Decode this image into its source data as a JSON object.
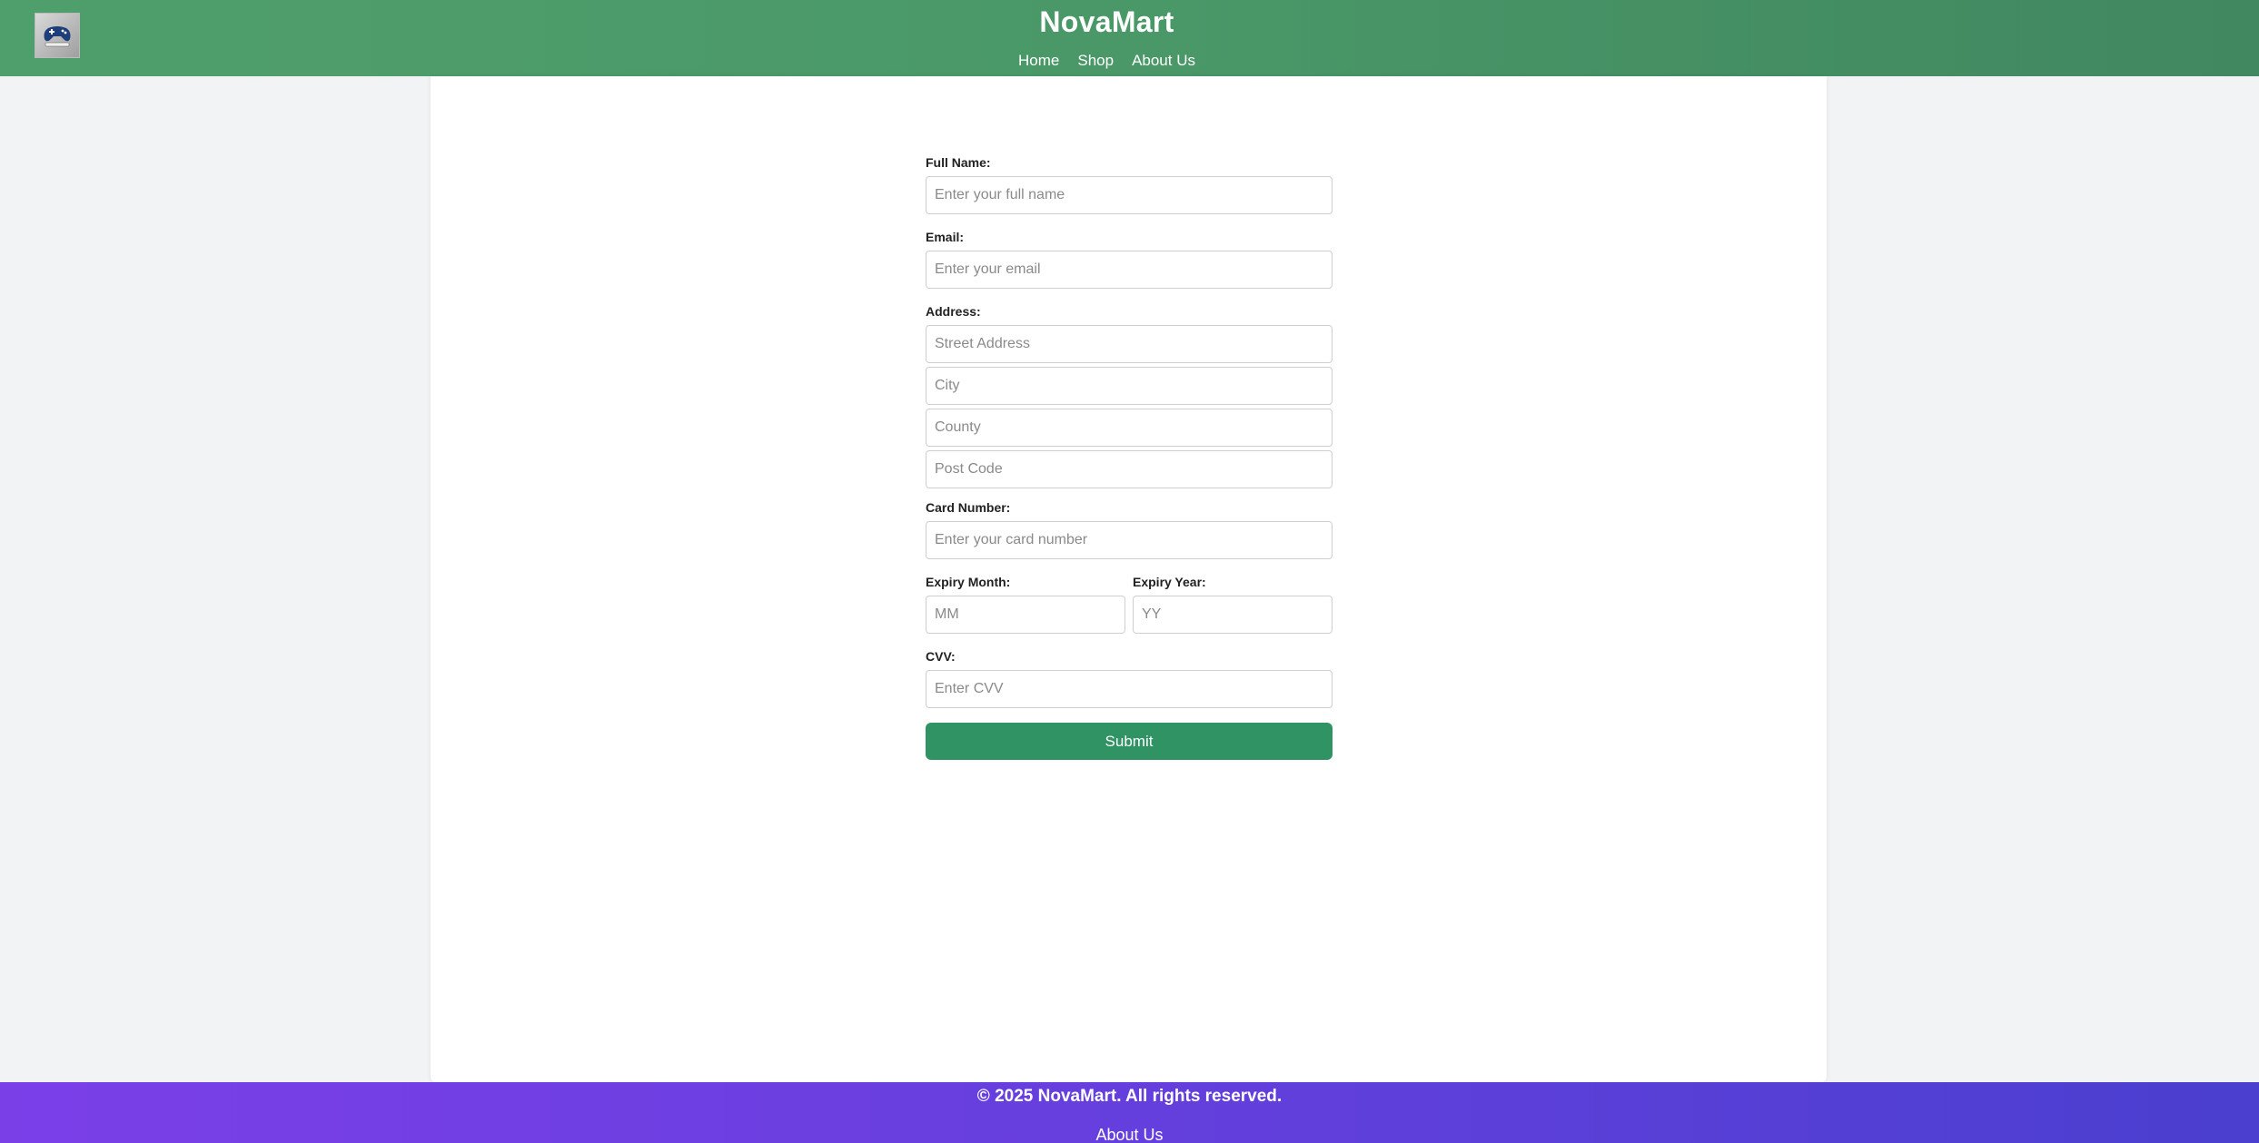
{
  "header": {
    "brand": "NovaMart",
    "logo_icon": "gamepad-logo-icon",
    "nav": [
      "Home",
      "Shop",
      "About Us"
    ]
  },
  "form": {
    "full_name": {
      "label": "Full Name:",
      "placeholder": "Enter your full name",
      "value": ""
    },
    "email": {
      "label": "Email:",
      "placeholder": "Enter your email",
      "value": ""
    },
    "address": {
      "label": "Address:",
      "street_placeholder": "Street Address",
      "city_placeholder": "City",
      "county_placeholder": "County",
      "postcode_placeholder": "Post Code"
    },
    "card_number": {
      "label": "Card Number:",
      "placeholder": "Enter your card number",
      "value": ""
    },
    "expiry_month": {
      "label": "Expiry Month:",
      "placeholder": "MM",
      "value": ""
    },
    "expiry_year": {
      "label": "Expiry Year:",
      "placeholder": "YY",
      "value": ""
    },
    "cvv": {
      "label": "CVV:",
      "placeholder": "Enter CVV",
      "value": ""
    },
    "submit_label": "Submit"
  },
  "footer": {
    "copyright": "© 2025 NovaMart. All rights reserved.",
    "link": "About Us"
  },
  "colors": {
    "header_green": "#4a9868",
    "submit_green": "#2f9364",
    "footer_purple": "#6a3fe0"
  }
}
